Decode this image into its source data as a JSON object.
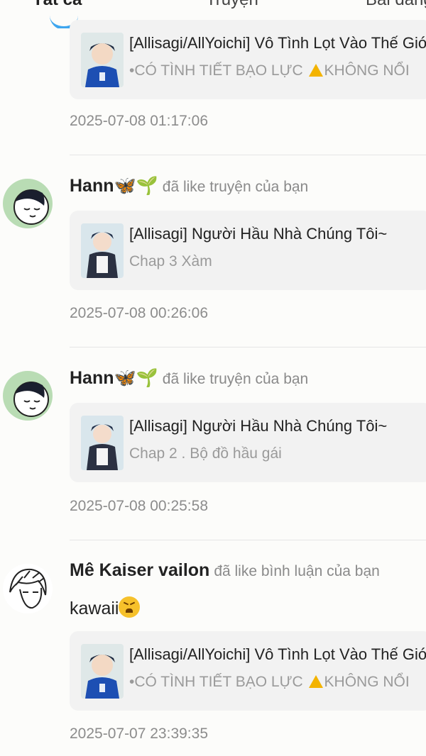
{
  "tabs": [
    "Tất cả",
    "Truyện",
    "Bài đăng"
  ],
  "accent_color": "#3ea6ef",
  "notifications": [
    {
      "story_title": "[Allisagi/AllYoichi] Vô Tình Lọt Vào Thế Giới",
      "story_sub_before": "•CÓ TÌNH TIẾT BẠO LỰC ",
      "story_sub_after": "KHÔNG NỔI",
      "time": "2025-07-08 01:17:06"
    },
    {
      "user": "Hann🦋🌱",
      "action": "đã like truyện của bạn",
      "story_title": "[Allisagi] Người Hầu Nhà Chúng Tôi~",
      "story_sub": "Chap 3 Xàm",
      "time": "2025-07-08 00:26:06"
    },
    {
      "user": "Hann🦋🌱",
      "action": "đã like truyện của bạn",
      "story_title": "[Allisagi] Người Hầu Nhà Chúng Tôi~",
      "story_sub": "Chap 2 . Bộ đồ hầu gái",
      "time": "2025-07-08 00:25:58"
    },
    {
      "user": "Mê Kaiser vailon",
      "action": "đã like bình luận của bạn",
      "comment": "kawaii",
      "story_title": "[Allisagi/AllYoichi] Vô Tình Lọt Vào Thế Giới",
      "story_sub_before": "•CÓ TÌNH TIẾT BẠO LỰC ",
      "story_sub_after": "KHÔNG NỔI",
      "time": "2025-07-07 23:39:35"
    }
  ]
}
